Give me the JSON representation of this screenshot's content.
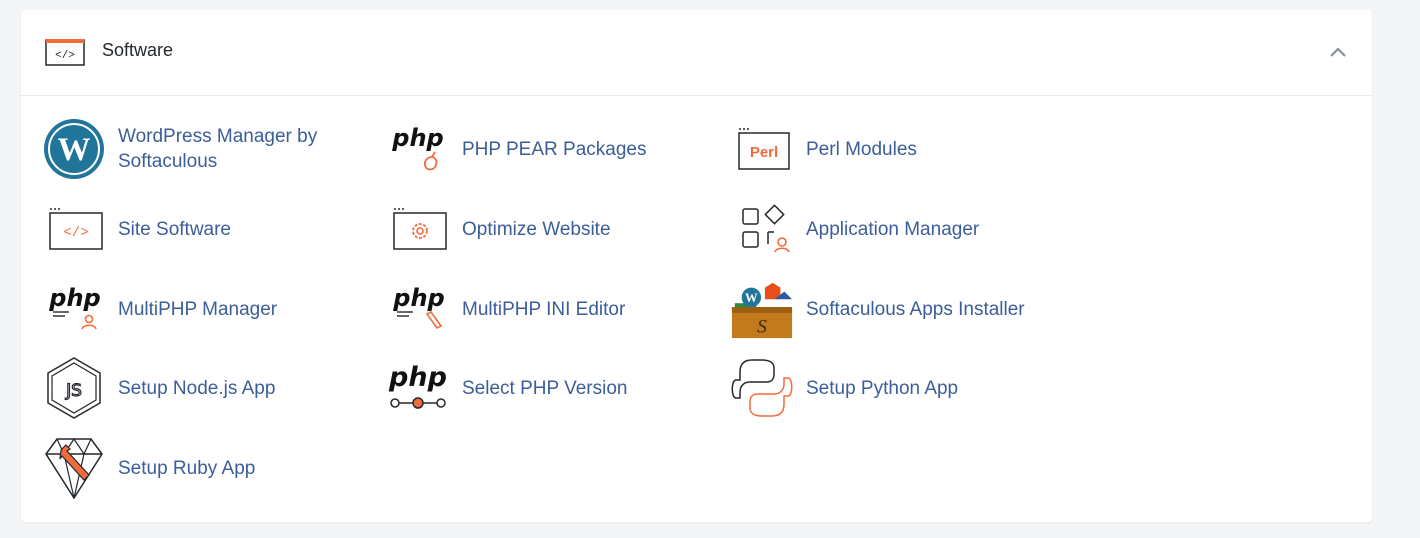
{
  "section": {
    "title": "Software",
    "header_icon": "code-window-icon",
    "collapse_icon": "chevron-up-icon"
  },
  "items": [
    {
      "label": "WordPress Manager by Softaculous",
      "icon": "wordpress-icon"
    },
    {
      "label": "PHP PEAR Packages",
      "icon": "php-pear-icon",
      "icon_text": "php"
    },
    {
      "label": "Perl Modules",
      "icon": "perl-icon",
      "icon_text": "Perl"
    },
    {
      "label": "Site Software",
      "icon": "code-window-icon"
    },
    {
      "label": "Optimize Website",
      "icon": "optimize-gear-icon"
    },
    {
      "label": "Application Manager",
      "icon": "app-grid-icon"
    },
    {
      "label": "MultiPHP Manager",
      "icon": "multiphp-manager-icon",
      "icon_text": "php"
    },
    {
      "label": "MultiPHP INI Editor",
      "icon": "multiphp-ini-icon",
      "icon_text": "php"
    },
    {
      "label": "Softaculous Apps Installer",
      "icon": "softaculous-box-icon"
    },
    {
      "label": "Setup Node.js App",
      "icon": "nodejs-icon"
    },
    {
      "label": "Select PHP Version",
      "icon": "php-version-icon",
      "icon_text": "php"
    },
    {
      "label": "Setup Python App",
      "icon": "python-icon"
    },
    {
      "label": "Setup Ruby App",
      "icon": "ruby-gem-icon"
    }
  ],
  "colors": {
    "accent": "#f26b3a",
    "link": "#3b5e99",
    "title": "#23282d",
    "wordpress": "#21759b"
  }
}
